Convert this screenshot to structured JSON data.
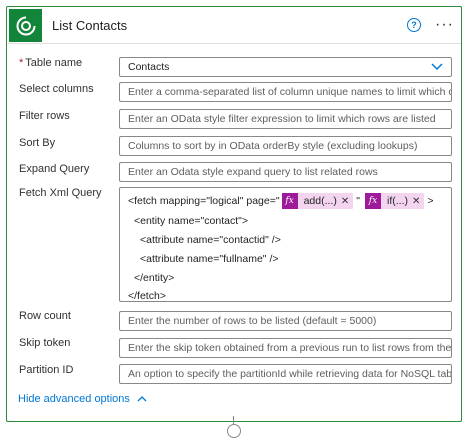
{
  "header": {
    "title": "List Contacts",
    "help_icon": "question-circle-icon",
    "help_glyph": "?",
    "more_glyph": "···"
  },
  "fields": {
    "table_name": {
      "label": "Table name",
      "required_mark": "*",
      "value": "Contacts"
    },
    "select_columns": {
      "label": "Select columns",
      "placeholder": "Enter a comma-separated list of column unique names to limit which columns"
    },
    "filter_rows": {
      "label": "Filter rows",
      "placeholder": "Enter an OData style filter expression to limit which rows are listed"
    },
    "sort_by": {
      "label": "Sort By",
      "placeholder": "Columns to sort by in OData orderBy style (excluding lookups)"
    },
    "expand_query": {
      "label": "Expand Query",
      "placeholder": "Enter an Odata style expand query to list related rows"
    },
    "fetch_xml": {
      "label": "Fetch Xml Query",
      "line1_prefix": "<fetch mapping=\"logical\" page=\"",
      "token1": "add(...)",
      "quote_sep": "\"",
      "token2": "if(...)",
      "line1_suffix": ">",
      "fx_glyph": "fx",
      "remove_glyph": "✕",
      "line2": "<entity name=\"contact\">",
      "line3": "<attribute name=\"contactid\" />",
      "line4": "<attribute name=\"fullname\" />",
      "line5": "</entity>",
      "line6": "</fetch>"
    },
    "row_count": {
      "label": "Row count",
      "placeholder": "Enter the number of rows to be listed (default = 5000)"
    },
    "skip_token": {
      "label": "Skip token",
      "placeholder": "Enter the skip token obtained from a previous run to list rows from the next pa"
    },
    "partition_id": {
      "label": "Partition ID",
      "placeholder": "An option to specify the partitionId while retrieving data for NoSQL tables"
    }
  },
  "footer": {
    "hide_advanced": "Hide advanced options"
  },
  "colors": {
    "brand": "#13853b",
    "accent": "#0078d4",
    "token_bg": "#f3d5f0",
    "token_fx": "#9d1b9a"
  }
}
